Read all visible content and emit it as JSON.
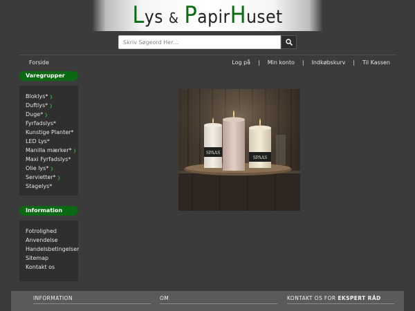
{
  "header": {
    "logo_parts": {
      "l1": "L",
      "l2": "ys ",
      "amp": "&",
      "p1": "P",
      "p2": "apir",
      "h1": "H",
      "h2": "uset"
    },
    "logo_alt": "Lys & PapirHuset"
  },
  "search": {
    "placeholder": "Skriv Søgeord Her…",
    "button_icon": "search-icon"
  },
  "nav": {
    "home": "Forside",
    "links": [
      "Log på",
      "Min konto",
      "Indkøbskurv",
      "Til Kassen"
    ],
    "separator": "|"
  },
  "sidebar": {
    "categories_title": "Varegrupper",
    "categories": [
      {
        "label": "Bloklys*",
        "has_arrow": true
      },
      {
        "label": "Duftlys*",
        "has_arrow": true
      },
      {
        "label": "Duge*",
        "has_arrow": true
      },
      {
        "label": "Fyrfadslys*",
        "has_arrow": false
      },
      {
        "label": "Kunstige Planter*",
        "has_arrow": false
      },
      {
        "label": "LED Lys*",
        "has_arrow": false
      },
      {
        "label": "Manilla mærker*",
        "has_arrow": true
      },
      {
        "label": "Maxi Fyrfadslys*",
        "has_arrow": false
      },
      {
        "label": "Olie lys*",
        "has_arrow": true
      },
      {
        "label": "Servietter*",
        "has_arrow": true
      },
      {
        "label": "Stagelys*",
        "has_arrow": false
      }
    ],
    "info_title": "Information",
    "info_items": [
      "Fotrolighed",
      "Anvendelse",
      "Handelsbetingelser",
      "Sitemap",
      "Kontakt os"
    ]
  },
  "hero": {
    "candle_brand": "SPAAS"
  },
  "footer": {
    "col1_title": "INFORMATION",
    "col2_title": "OM",
    "col3_title_prefix": "KONTAKT OS FOR ",
    "col3_title_bold": "EKSPERT RÅD"
  },
  "colors": {
    "background": "#3b3b3b",
    "accent_green": "#0a6912",
    "panel": "#2f2f2f"
  }
}
